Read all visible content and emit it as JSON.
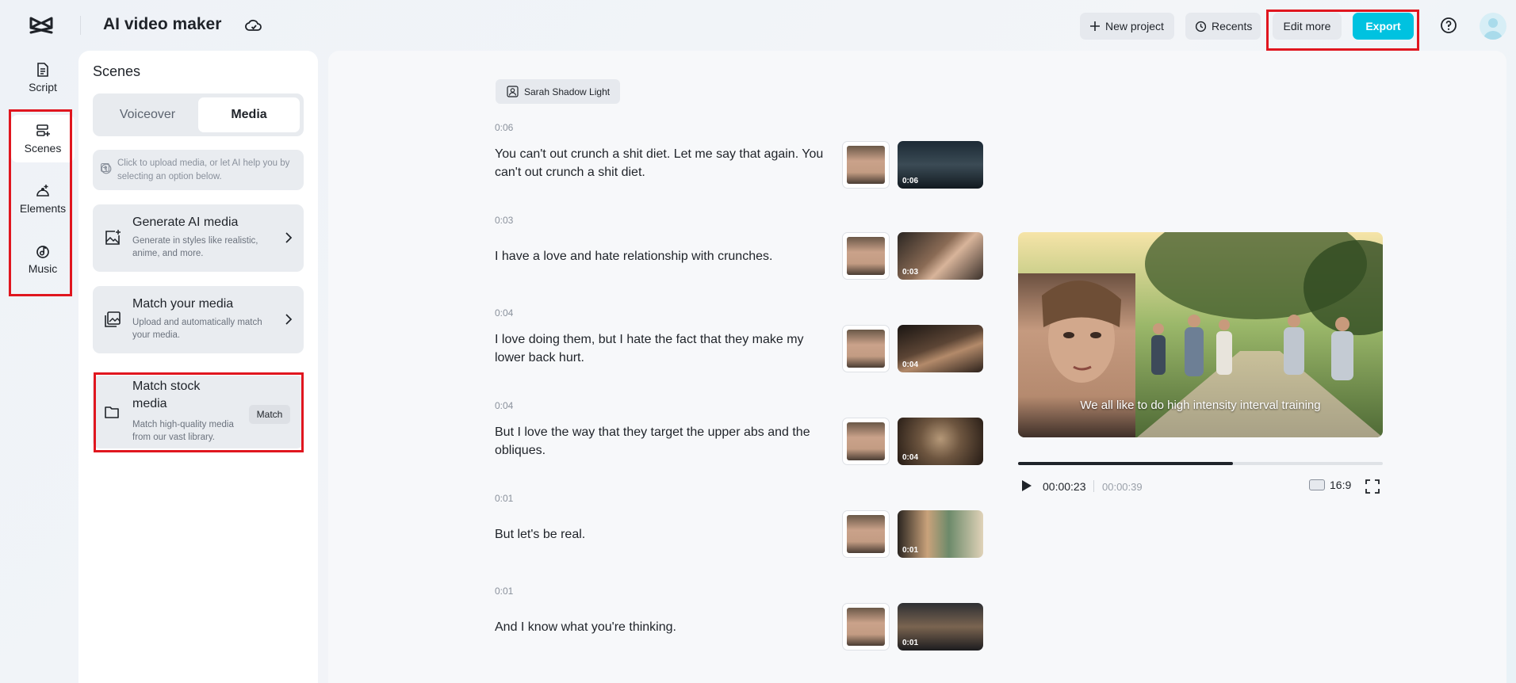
{
  "header": {
    "app_title": "AI video maker",
    "new_project_label": "New project",
    "recents_label": "Recents",
    "edit_more_label": "Edit more",
    "export_label": "Export",
    "icons": [
      "capcut-logo-icon",
      "cloud-sync-icon",
      "plus-icon",
      "clock-icon",
      "help-icon",
      "user-avatar"
    ]
  },
  "rail": {
    "items": [
      {
        "label": "Script",
        "icon": "script-icon"
      },
      {
        "label": "Scenes",
        "icon": "scenes-icon",
        "active": true
      },
      {
        "label": "Elements",
        "icon": "elements-icon"
      },
      {
        "label": "Music",
        "icon": "music-icon"
      }
    ]
  },
  "panel": {
    "title": "Scenes",
    "tabs": {
      "voiceover": "Voiceover",
      "media": "Media",
      "selected": "Media"
    },
    "hint_pre": "Click",
    "hint_post": "to upload media, or let AI help you by selecting an option below.",
    "cards": [
      {
        "title": "Generate AI media",
        "desc": "Generate in styles like realistic, anime, and more."
      },
      {
        "title": "Match your media",
        "desc": "Upload and automatically match your media."
      },
      {
        "title": "Match stock media",
        "desc": "Match high-quality media from our vast library.",
        "button": "Match"
      }
    ]
  },
  "main": {
    "voice_label": "Sarah Shadow Light",
    "scenes": [
      {
        "duration": "0:06",
        "text": "You can't out crunch a shit diet. Let me say that again. You can't out crunch a shit diet.",
        "clip": "0:06"
      },
      {
        "duration": "0:03",
        "text": "I have a love and hate relationship with crunches.",
        "clip": "0:03"
      },
      {
        "duration": "0:04",
        "text": "I love doing them, but I hate the fact that they make my lower back hurt.",
        "clip": "0:04"
      },
      {
        "duration": "0:04",
        "text": "But I love the way that they target the upper abs and the obliques.",
        "clip": "0:04"
      },
      {
        "duration": "0:01",
        "text": "But let's be real.",
        "clip": "0:01"
      },
      {
        "duration": "0:01",
        "text": "And I know what you're thinking.",
        "clip": "0:01"
      }
    ]
  },
  "preview": {
    "caption": "We all like to do high intensity interval training",
    "current_time": "00:00:23",
    "total_time": "00:00:39",
    "progress": 0.59,
    "aspect_ratio": "16:9"
  },
  "colors": {
    "accent": "#00c2e0",
    "highlight": "#e0161f",
    "panel_bg": "#ffffff",
    "card_bg": "#e9ecf0"
  }
}
